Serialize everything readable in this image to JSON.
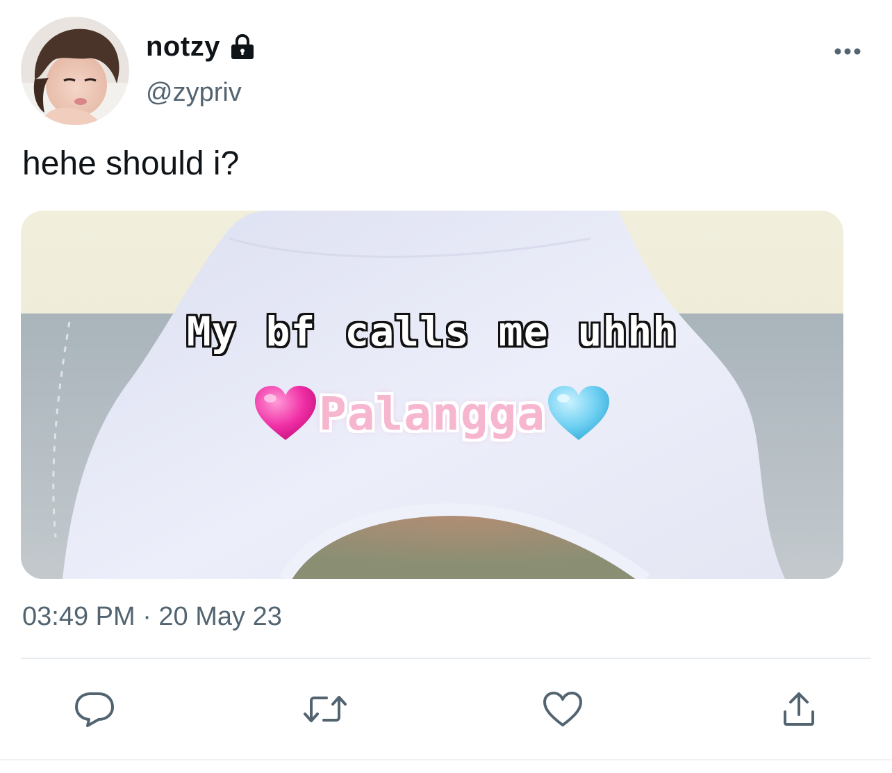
{
  "author": {
    "display_name": "notzy",
    "handle": "@zypriv",
    "avatar_icon": "profile-photo",
    "protected_icon": "lock-icon"
  },
  "tweet": {
    "text": "hehe should i?",
    "timestamp": "03:49 PM · 20 May 23"
  },
  "media": {
    "caption_line1": "My bf calls me uhhh",
    "caption_line2": "Palangga",
    "left_emoji": "pink-heart-icon",
    "right_emoji": "light-blue-heart-icon"
  },
  "actions": [
    {
      "name": "reply",
      "icon": "speech-bubble-icon"
    },
    {
      "name": "retweet",
      "icon": "retweet-icon"
    },
    {
      "name": "like",
      "icon": "heart-icon"
    },
    {
      "name": "share",
      "icon": "share-icon"
    }
  ],
  "colors": {
    "text_primary": "#0f1419",
    "text_secondary": "#536471",
    "divider": "#e6ecf0",
    "icon_gray": "#536471"
  }
}
